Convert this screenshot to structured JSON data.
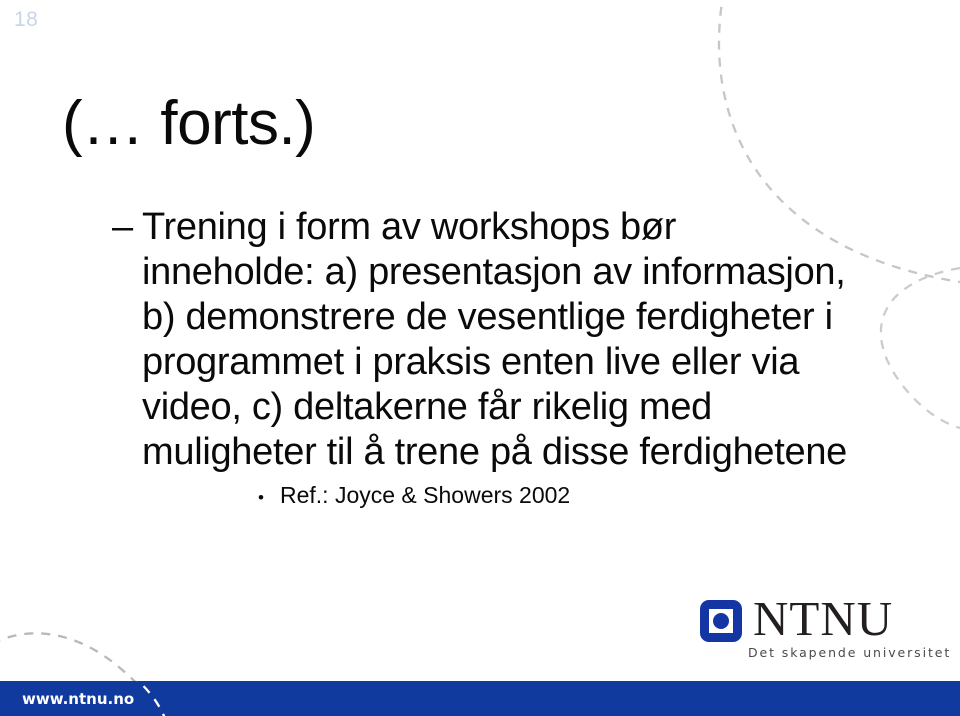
{
  "slide": {
    "page_number": "18",
    "title": "(… forts.)",
    "body_lines": [
      {
        "marker": "–",
        "text": "Trening i form av workshops bør"
      },
      {
        "marker": "",
        "text": "inneholde: a) presentasjon av informasjon,"
      },
      {
        "marker": "",
        "text": "b) demonstrere de vesentlige ferdigheter i"
      },
      {
        "marker": "",
        "text": "programmet i praksis enten live eller via"
      },
      {
        "marker": "",
        "text": "video, c) deltakerne får rikelig med"
      },
      {
        "marker": "",
        "text": "muligheter til å trene på disse ferdighetene"
      }
    ],
    "reference": {
      "bullet": "•",
      "text": "Ref.: Joyce & Showers 2002"
    }
  },
  "logo": {
    "wordmark": "NTNU",
    "tagline": "Det skapende universitet"
  },
  "footer": {
    "url": "www.ntnu.no"
  },
  "colors": {
    "footer_blue": "#103A9E",
    "logo_blue": "#1436A4",
    "page_number": "#c9d6e4",
    "text": "#0a0a0a",
    "decor_dash": "#c3c3c3"
  }
}
